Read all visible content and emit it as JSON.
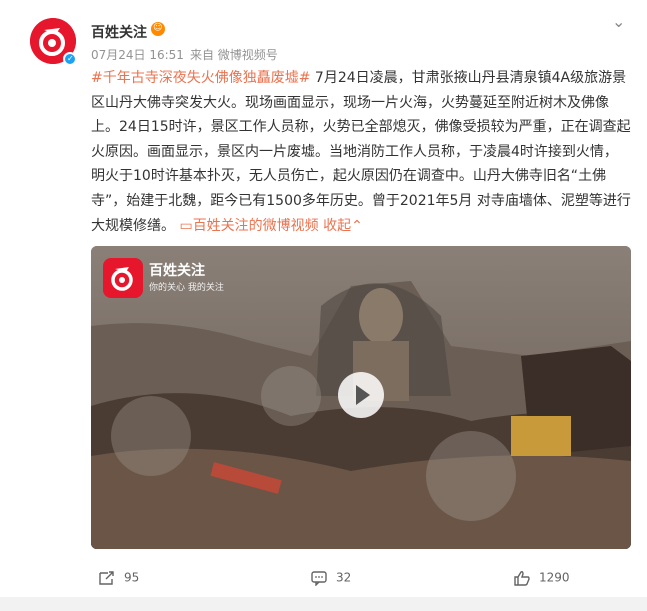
{
  "post": {
    "author": "百姓关注",
    "time": "07月24日 16:51",
    "source": "来自 微博视频号",
    "hashtag": "#千年古寺深夜失火佛像独矗废墟#",
    "body": " 7月24日凌晨，甘肃张掖山丹县清泉镇4A级旅游景区山丹大佛寺突发大火。现场画面显示，现场一片火海，火势蔓延至附近树木及佛像上。24日15时许，景区工作人员称，火势已全部熄灭，佛像受损较为严重，正在调查起火原因。画面显示，景区内一片废墟。当地消防工作人员称，于凌晨4时许接到火情，明火于10时许基本扑灭，无人员伤亡，起火原因仍在调查中。山丹大佛寺旧名“土佛寺”，始建于北魏，距今已有1500多年历史。曾于2021年5月 对寺庙墙体、泥塑等进行大规模修缮。",
    "video_link": "百姓关注的微博视频",
    "collapse": "收起"
  },
  "video": {
    "logo_title": "百姓关注",
    "logo_sub": "你的关心 我的关注"
  },
  "actions": {
    "reposts": "95",
    "comments": "32",
    "likes": "1290"
  },
  "colors": {
    "brand": "#e6162d",
    "link": "#eb7350"
  }
}
